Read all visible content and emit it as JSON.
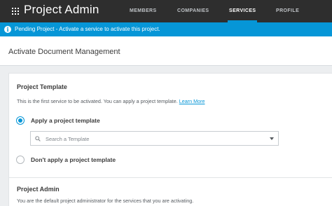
{
  "app": {
    "title": "Project Admin"
  },
  "nav": {
    "tabs": [
      {
        "label": "MEMBERS",
        "active": false
      },
      {
        "label": "COMPANIES",
        "active": false
      },
      {
        "label": "SERVICES",
        "active": true
      },
      {
        "label": "PROFILE",
        "active": false
      }
    ]
  },
  "banner": {
    "text": "Pending Project - Activate a service to activate this project.",
    "icon": "info-icon"
  },
  "page": {
    "title": "Activate Document Management"
  },
  "template_section": {
    "title": "Project Template",
    "description": "This is the first service to be activated. You can apply a project template.",
    "learn_more": "Learn More",
    "option_apply": "Apply a project template",
    "option_apply_selected": true,
    "search_placeholder": "Search a Template",
    "option_skip": "Don't apply a project template",
    "option_skip_selected": false
  },
  "admin_section": {
    "title": "Project Admin",
    "description": "You are the default project administrator for the services that you are activating."
  },
  "colors": {
    "topbar": "#2e2e2e",
    "accent": "#0696d7",
    "background": "#eceef0"
  }
}
